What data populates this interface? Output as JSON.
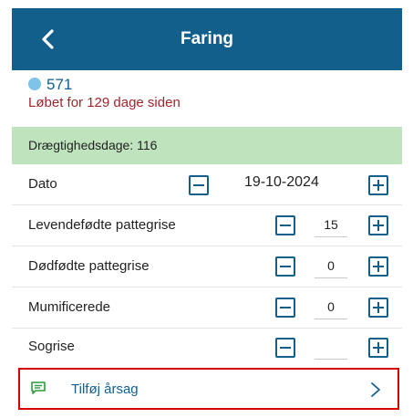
{
  "header": {
    "title": "Faring",
    "back_icon": "chevron-left-icon"
  },
  "animal": {
    "number": "571",
    "status_text": "Løbet for 129 dage siden",
    "dot_color": "#7fc3e8"
  },
  "banner": {
    "text": "Drægtighedsdage: 116",
    "color": "#bfe3bd"
  },
  "rows": [
    {
      "label": "Dato",
      "value": "19-10-2024"
    },
    {
      "label": "Levendefødte pattegrise",
      "value": "15"
    },
    {
      "label": "Dødfødte pattegrise",
      "value": "0"
    },
    {
      "label": "Mumificerede",
      "value": "0"
    },
    {
      "label": "Sogrise",
      "value": ""
    }
  ],
  "reason": {
    "label": "Tilføj årsag",
    "icon": "message-icon",
    "chevron": "chevron-right-icon"
  },
  "colors": {
    "primary": "#135f8c",
    "alert": "#a1262c",
    "highlight_border": "#d40000"
  }
}
